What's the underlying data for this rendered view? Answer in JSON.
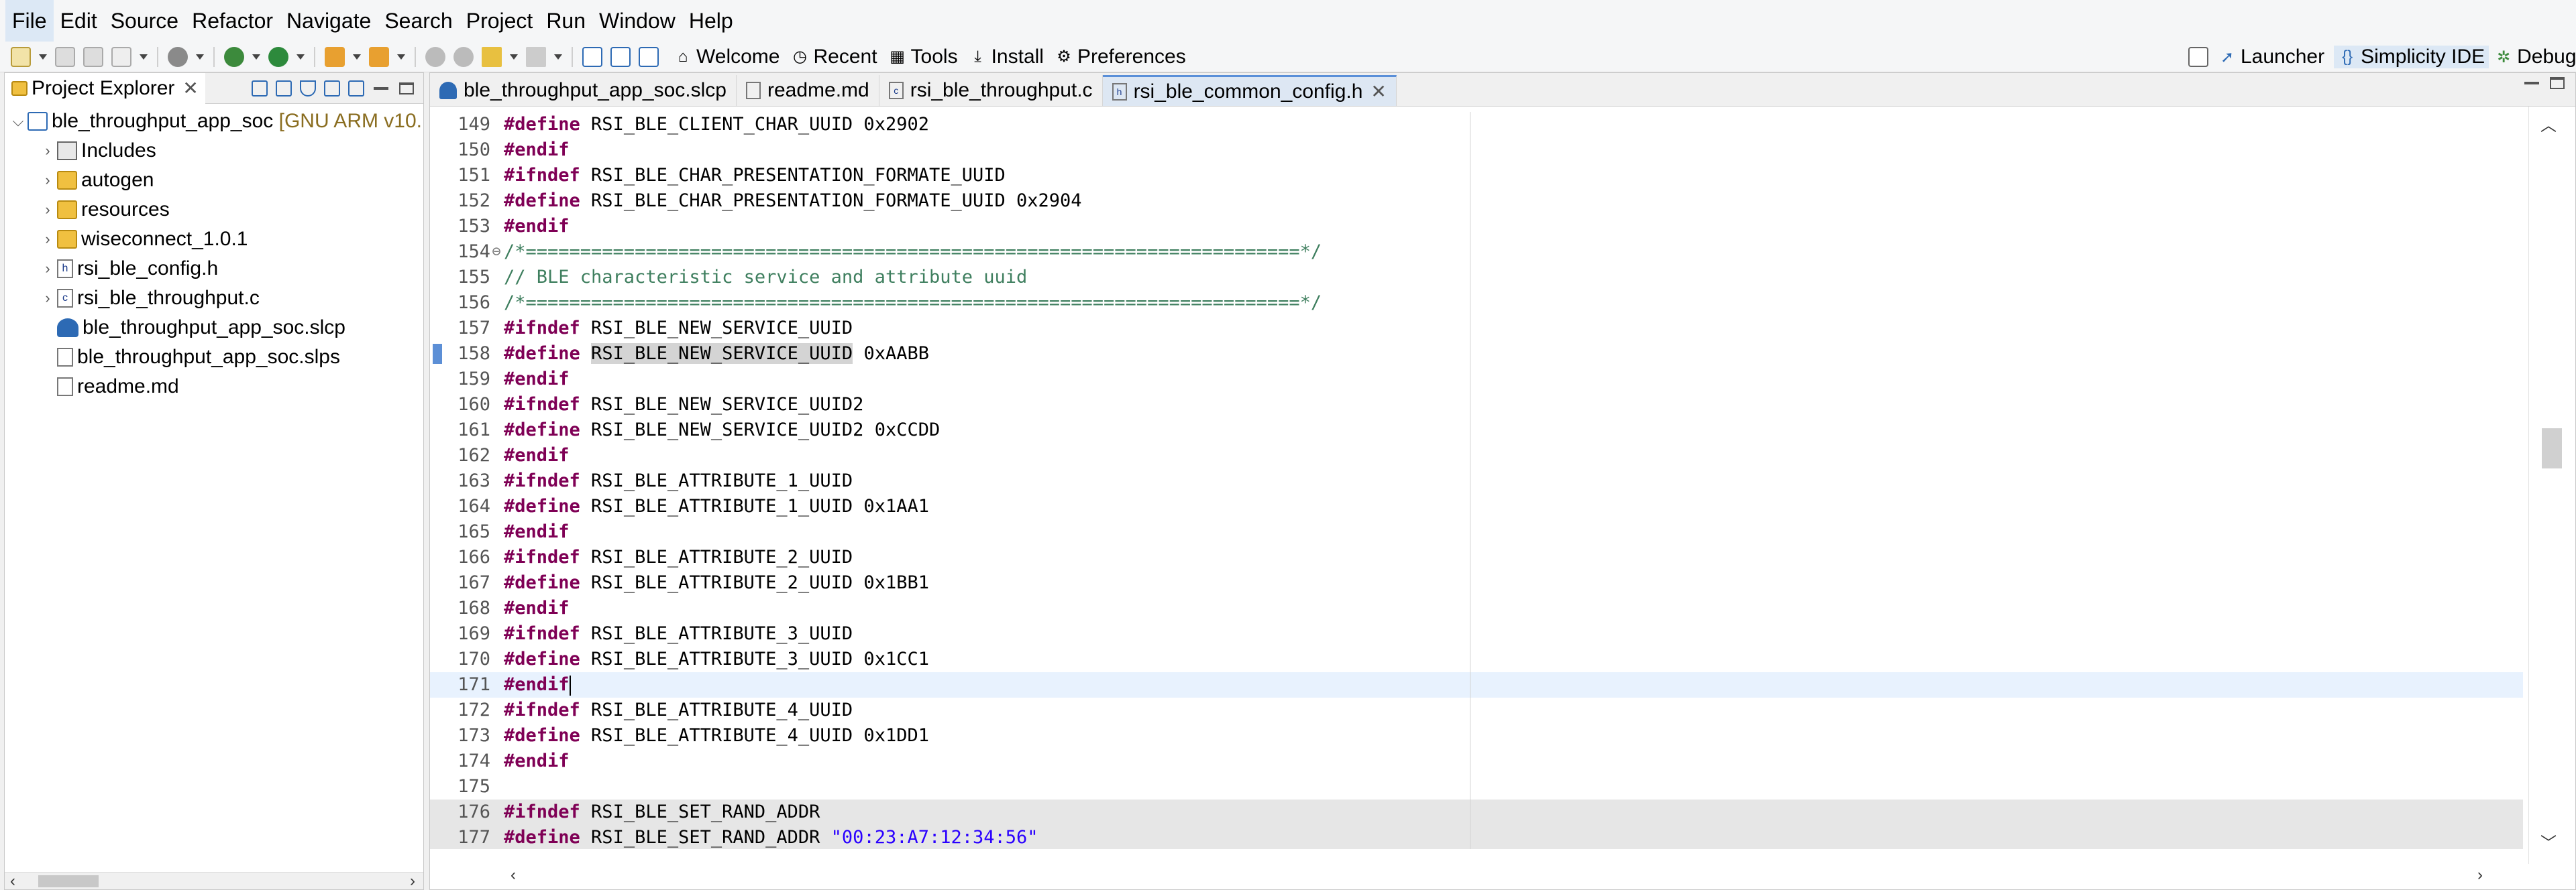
{
  "menu": [
    "File",
    "Edit",
    "Source",
    "Refactor",
    "Navigate",
    "Search",
    "Project",
    "Run",
    "Window",
    "Help"
  ],
  "toolbar": {
    "welcome": "Welcome",
    "recent": "Recent",
    "tools": "Tools",
    "install": "Install",
    "preferences": "Preferences"
  },
  "perspectives": {
    "launcher": "Launcher",
    "ide": "Simplicity IDE",
    "debug": "Debug"
  },
  "explorer": {
    "title": "Project Explorer",
    "project": "ble_throughput_app_soc",
    "project_suffix": "[GNU ARM v10.",
    "items": [
      {
        "label": "Includes",
        "type": "lib",
        "expandable": true
      },
      {
        "label": "autogen",
        "type": "folder",
        "expandable": true
      },
      {
        "label": "resources",
        "type": "folder",
        "expandable": true
      },
      {
        "label": "wiseconnect_1.0.1",
        "type": "folder",
        "expandable": true
      },
      {
        "label": "rsi_ble_config.h",
        "type": "hfile",
        "expandable": true
      },
      {
        "label": "rsi_ble_throughput.c",
        "type": "cfile",
        "expandable": true
      },
      {
        "label": "ble_throughput_app_soc.slcp",
        "type": "slcp",
        "expandable": false
      },
      {
        "label": "ble_throughput_app_soc.slps",
        "type": "file",
        "expandable": false
      },
      {
        "label": "readme.md",
        "type": "file",
        "expandable": false
      }
    ]
  },
  "tabs": [
    {
      "label": "ble_throughput_app_soc.slcp",
      "icon": "slcp"
    },
    {
      "label": "readme.md",
      "icon": "file"
    },
    {
      "label": "rsi_ble_throughput.c",
      "icon": "cfile"
    },
    {
      "label": "rsi_ble_common_config.h",
      "icon": "hfile",
      "active": true
    }
  ],
  "code": [
    {
      "n": "149",
      "t": [
        [
          "kw",
          "#define"
        ],
        [
          "",
          " RSI_BLE_CLIENT_CHAR_UUID 0x2902"
        ]
      ]
    },
    {
      "n": "150",
      "t": [
        [
          "kw",
          "#endif"
        ]
      ]
    },
    {
      "n": "151",
      "t": [
        [
          "kw",
          "#ifndef"
        ],
        [
          "",
          " RSI_BLE_CHAR_PRESENTATION_FORMATE_UUID"
        ]
      ]
    },
    {
      "n": "152",
      "t": [
        [
          "kw",
          "#define"
        ],
        [
          "",
          " RSI_BLE_CHAR_PRESENTATION_FORMATE_UUID 0x2904"
        ]
      ]
    },
    {
      "n": "153",
      "t": [
        [
          "kw",
          "#endif"
        ]
      ]
    },
    {
      "n": "154",
      "fold": true,
      "t": [
        [
          "cm",
          "/*=======================================================================*/"
        ]
      ]
    },
    {
      "n": "155",
      "t": [
        [
          "cm",
          "// BLE characteristic service and attribute uuid"
        ]
      ]
    },
    {
      "n": "156",
      "t": [
        [
          "cm",
          "/*=======================================================================*/"
        ]
      ]
    },
    {
      "n": "157",
      "t": [
        [
          "kw",
          "#ifndef"
        ],
        [
          "",
          " RSI_BLE_NEW_SERVICE_UUID"
        ]
      ]
    },
    {
      "n": "158",
      "marker": true,
      "t": [
        [
          "kw",
          "#define"
        ],
        [
          "",
          " "
        ],
        [
          "hl",
          "RSI_BLE_NEW_SERVICE_UUID"
        ],
        [
          "",
          " 0xAABB"
        ]
      ]
    },
    {
      "n": "159",
      "t": [
        [
          "kw",
          "#endif"
        ]
      ]
    },
    {
      "n": "160",
      "t": [
        [
          "kw",
          "#ifndef"
        ],
        [
          "",
          " RSI_BLE_NEW_SERVICE_UUID2"
        ]
      ]
    },
    {
      "n": "161",
      "t": [
        [
          "kw",
          "#define"
        ],
        [
          "",
          " RSI_BLE_NEW_SERVICE_UUID2 0xCCDD"
        ]
      ]
    },
    {
      "n": "162",
      "t": [
        [
          "kw",
          "#endif"
        ]
      ]
    },
    {
      "n": "163",
      "t": [
        [
          "kw",
          "#ifndef"
        ],
        [
          "",
          " RSI_BLE_ATTRIBUTE_1_UUID"
        ]
      ]
    },
    {
      "n": "164",
      "t": [
        [
          "kw",
          "#define"
        ],
        [
          "",
          " RSI_BLE_ATTRIBUTE_1_UUID 0x1AA1"
        ]
      ]
    },
    {
      "n": "165",
      "t": [
        [
          "kw",
          "#endif"
        ]
      ]
    },
    {
      "n": "166",
      "t": [
        [
          "kw",
          "#ifndef"
        ],
        [
          "",
          " RSI_BLE_ATTRIBUTE_2_UUID"
        ]
      ]
    },
    {
      "n": "167",
      "t": [
        [
          "kw",
          "#define"
        ],
        [
          "",
          " RSI_BLE_ATTRIBUTE_2_UUID 0x1BB1"
        ]
      ]
    },
    {
      "n": "168",
      "t": [
        [
          "kw",
          "#endif"
        ]
      ]
    },
    {
      "n": "169",
      "t": [
        [
          "kw",
          "#ifndef"
        ],
        [
          "",
          " RSI_BLE_ATTRIBUTE_3_UUID"
        ]
      ]
    },
    {
      "n": "170",
      "t": [
        [
          "kw",
          "#define"
        ],
        [
          "",
          " RSI_BLE_ATTRIBUTE_3_UUID 0x1CC1"
        ]
      ]
    },
    {
      "n": "171",
      "current": true,
      "caret": true,
      "t": [
        [
          "kw",
          "#endif"
        ]
      ]
    },
    {
      "n": "172",
      "t": [
        [
          "kw",
          "#ifndef"
        ],
        [
          "",
          " RSI_BLE_ATTRIBUTE_4_UUID"
        ]
      ]
    },
    {
      "n": "173",
      "t": [
        [
          "kw",
          "#define"
        ],
        [
          "",
          " RSI_BLE_ATTRIBUTE_4_UUID 0x1DD1"
        ]
      ]
    },
    {
      "n": "174",
      "t": [
        [
          "kw",
          "#endif"
        ]
      ]
    },
    {
      "n": "175",
      "t": []
    },
    {
      "n": "176",
      "shaded": true,
      "t": [
        [
          "kw",
          "#ifndef"
        ],
        [
          "",
          " RSI_BLE_SET_RAND_ADDR"
        ]
      ]
    },
    {
      "n": "177",
      "shaded": true,
      "t": [
        [
          "kw",
          "#define"
        ],
        [
          "",
          " RSI_BLE_SET_RAND_ADDR "
        ],
        [
          "str",
          "\"00:23:A7:12:34:56\""
        ]
      ]
    }
  ]
}
